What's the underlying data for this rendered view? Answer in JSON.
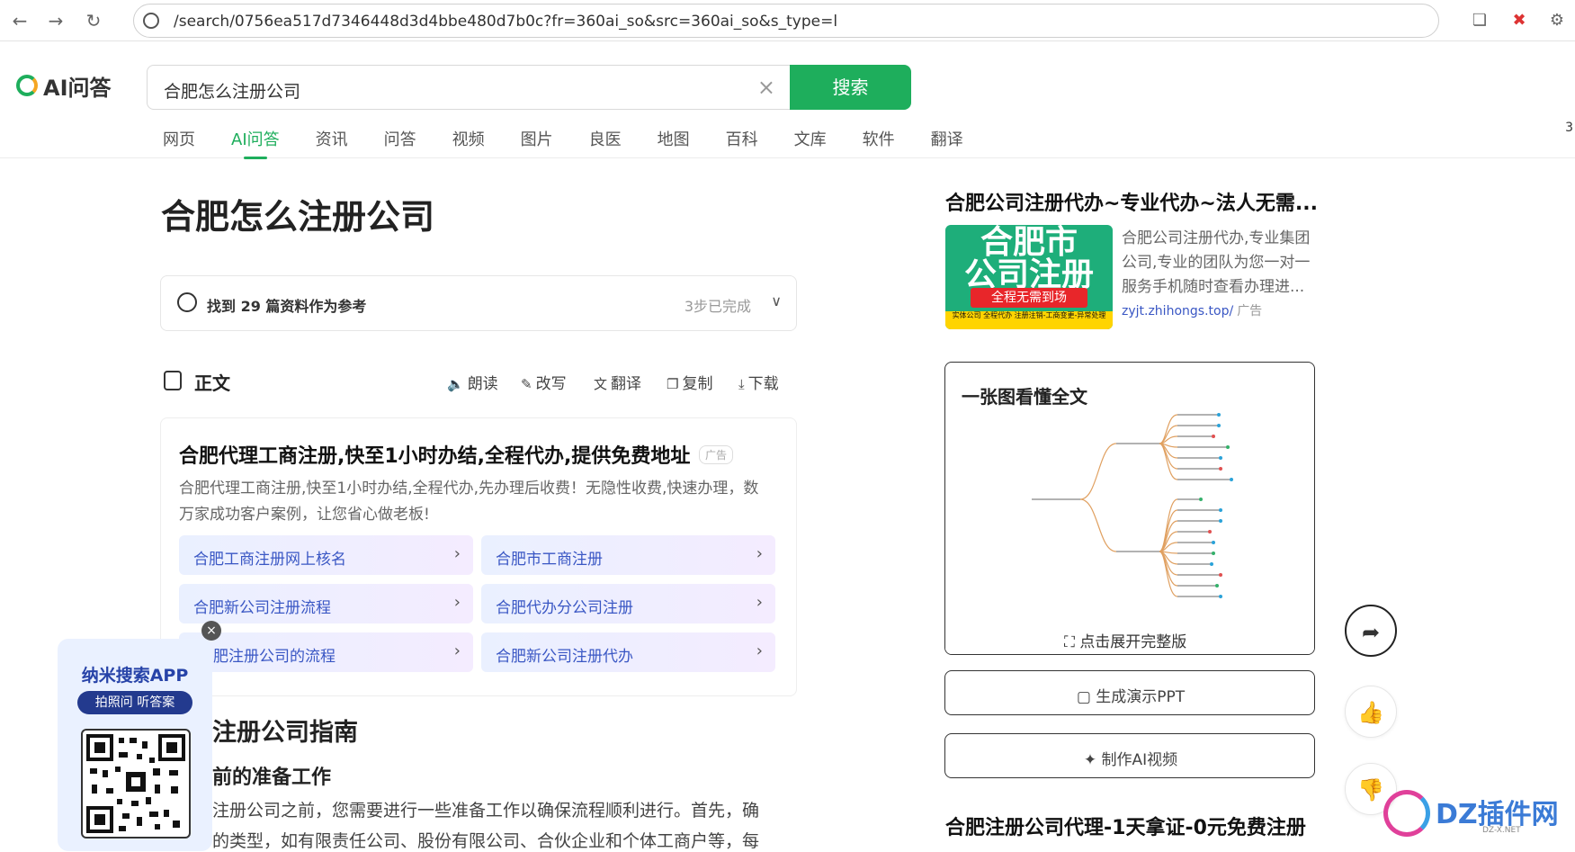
{
  "browser": {
    "url": "/search/0756ea517d7346448d3d4bbe480d7b0c?fr=360ai_so&src=360ai_so&s_type=l",
    "back_icon": "arrow-left-icon",
    "forward_icon": "arrow-right-icon",
    "reload_icon": "reload-icon"
  },
  "header": {
    "logo_text": "AI问答",
    "query": "合肥怎么注册公司",
    "search_button": "搜索",
    "right_edge_text": "3",
    "tabs": [
      "网页",
      "AI问答",
      "资讯",
      "问答",
      "视频",
      "图片",
      "良医",
      "地图",
      "百科",
      "文库",
      "软件",
      "翻译"
    ],
    "active_tab": "AI问答",
    "accent_color": "#1eae5c"
  },
  "main": {
    "title": "合肥怎么注册公司",
    "references": {
      "found_text": "找到 29 篇资料作为参考",
      "status": "3步已完成"
    },
    "body_label": "正文",
    "actions": [
      "朗读",
      "改写",
      "翻译",
      "复制",
      "下载"
    ],
    "ad": {
      "title": "合肥代理工商注册,快至1小时办结,全程代办,提供免费地址",
      "badge": "广告",
      "desc_line1": "合肥代理工商注册,快至1小时办结,全程代办,先办理后收费！无隐性收费,快速办理，数",
      "desc_line2": "万家成功客户案例，让您省心做老板!",
      "links": [
        "合肥工商注册网上核名",
        "合肥市工商注册",
        "合肥新公司注册流程",
        "合肥代办分公司注册",
        "肥注册公司的流程",
        "合肥新公司注册代办"
      ]
    },
    "section_heading": "注册公司指南",
    "sub_heading": "前的准备工作",
    "para_line1": "注册公司之前，您需要进行一些准备工作以确保流程顺利进行。首先，确",
    "para_line2": "的类型，如有限责任公司、股份有限公司、合伙企业和个体工商户等，每"
  },
  "app_promo": {
    "title": "纳米搜索APP",
    "tagline": "拍照问 听答案"
  },
  "sidebar": {
    "ad1": {
      "title": "合肥公司注册代办~专业代办~法人无需...",
      "image_line1": "合肥市",
      "image_line2": "公司注册",
      "image_banner": "全程无需到场",
      "image_small": "实体公司 全程代办\n注册注销-工商变更-异常处理",
      "desc": "合肥公司注册代办,专业集团公司,专业的团队为您一对一服务手机随时查看办理进...",
      "source": "zyjt.zhihongs.top/",
      "badge": "广告"
    },
    "mindmap": {
      "title": "一张图看懂全文",
      "expand_label": "点击展开完整版"
    },
    "ppt_button": "生成演示PPT",
    "video_button": "制作AI视频",
    "ad2_title": "合肥注册公司代理-1天拿证-0元免费注册"
  },
  "watermark": {
    "brand": "DZ插件网",
    "domain": "DZ-X.NET"
  }
}
